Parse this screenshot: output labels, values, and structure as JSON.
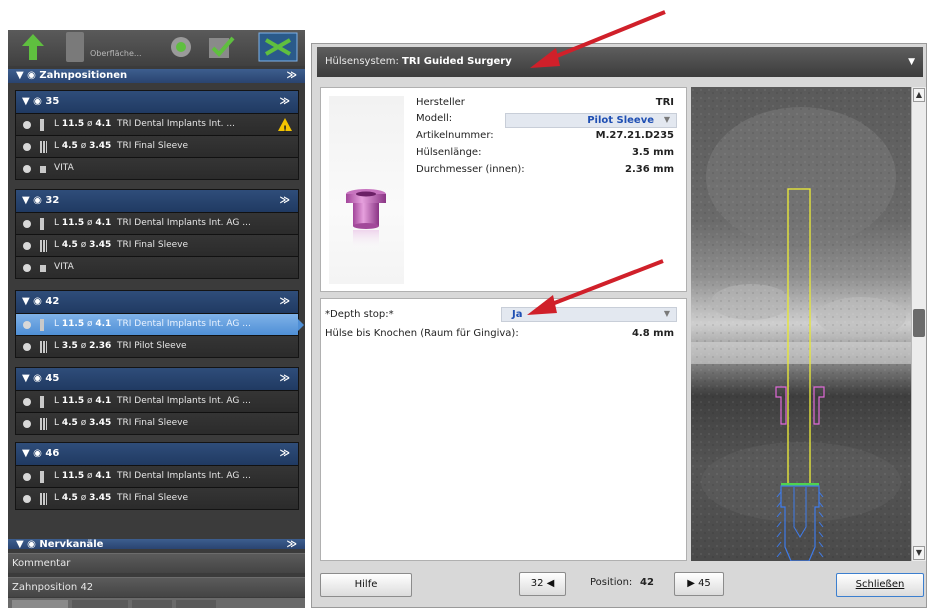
{
  "toolbar": {
    "subtext": "Oberfläche..."
  },
  "left": {
    "section_title": "Zahnpositionen",
    "groups": [
      {
        "tooth": "35",
        "rows": [
          {
            "kind": "implant",
            "L": "11.5",
            "d": "4.1",
            "desc": "TRI Dental Implants Int. ...",
            "warning": true
          },
          {
            "kind": "sleeve",
            "L": "4.5",
            "d": "3.45",
            "desc": "TRI Final Sleeve"
          },
          {
            "kind": "vita",
            "desc": "VITA"
          }
        ]
      },
      {
        "tooth": "32",
        "rows": [
          {
            "kind": "implant",
            "L": "11.5",
            "d": "4.1",
            "desc": "TRI Dental Implants Int. AG ..."
          },
          {
            "kind": "sleeve",
            "L": "4.5",
            "d": "3.45",
            "desc": "TRI Final Sleeve"
          },
          {
            "kind": "vita",
            "desc": "VITA"
          }
        ]
      },
      {
        "tooth": "42",
        "rows": [
          {
            "kind": "implant",
            "L": "11.5",
            "d": "4.1",
            "desc": "TRI Dental Implants Int. AG ...",
            "selected": true
          },
          {
            "kind": "sleeve",
            "L": "3.5",
            "d": "2.36",
            "desc": "TRI Pilot Sleeve"
          }
        ]
      },
      {
        "tooth": "45",
        "rows": [
          {
            "kind": "implant",
            "L": "11.5",
            "d": "4.1",
            "desc": "TRI Dental Implants Int. AG ..."
          },
          {
            "kind": "sleeve",
            "L": "4.5",
            "d": "3.45",
            "desc": "TRI Final Sleeve"
          }
        ]
      },
      {
        "tooth": "46",
        "rows": [
          {
            "kind": "implant",
            "L": "11.5",
            "d": "4.1",
            "desc": "TRI Dental Implants Int. AG ..."
          },
          {
            "kind": "sleeve",
            "L": "4.5",
            "d": "3.45",
            "desc": "TRI Final Sleeve"
          }
        ]
      }
    ],
    "section2_title": "Nervkanäle",
    "comment_label": "Kommentar",
    "position_label": "Zahnposition 42"
  },
  "dialog": {
    "header_prefix": "Hülsensystem:",
    "header_value": "TRI Guided Surgery",
    "props": {
      "hersteller_label": "Hersteller",
      "hersteller_value": "TRI",
      "modell_label": "Modell:",
      "modell_value": "Pilot Sleeve",
      "artikel_label": "Artikelnummer:",
      "artikel_value": "M.27.21.D235",
      "laenge_label": "Hülsenlänge:",
      "laenge_value": "3.5 mm",
      "durchmesser_label": "Durchmesser (innen):",
      "durchmesser_value": "2.36 mm"
    },
    "depth": {
      "stop_label": "*Depth stop:*",
      "stop_value": "Ja",
      "gingiva_label": "Hülse bis Knochen (Raum für Gingiva):",
      "gingiva_value": "4.8 mm"
    },
    "footer": {
      "help": "Hilfe",
      "prev": "32 ◀",
      "position_label": "Position:",
      "position_value": "42",
      "next": "▶ 45",
      "close": "Schließen"
    }
  },
  "colors": {
    "annotation_arrow": "#d0202a",
    "selection": "#4f8fd6",
    "accent_blue": "#1f4fb3"
  }
}
